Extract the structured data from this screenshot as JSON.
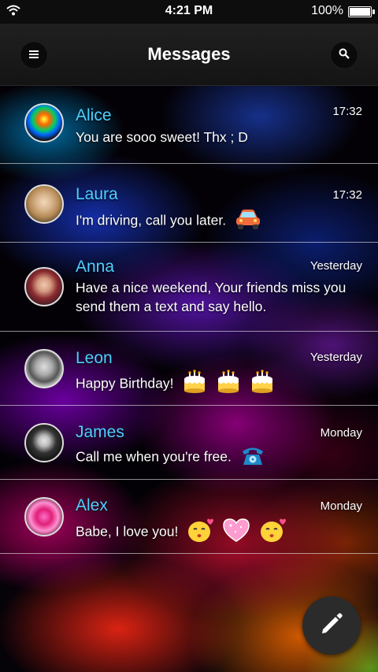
{
  "status_bar": {
    "time": "4:21 PM",
    "battery": "100%"
  },
  "header": {
    "title": "Messages",
    "menu_icon": "menu-icon",
    "search_icon": "search-icon"
  },
  "conversations": [
    {
      "name": "Alice",
      "time": "17:32",
      "message": "You are sooo sweet! Thx ; D",
      "emojis": []
    },
    {
      "name": "Laura",
      "time": "17:32",
      "message": "I'm driving, call you later.",
      "emojis": [
        "car-emoji"
      ]
    },
    {
      "name": "Anna",
      "time": "Yesterday",
      "message": "Have a nice weekend, Your friends miss you send them a text and say hello.",
      "emojis": []
    },
    {
      "name": "Leon",
      "time": "Yesterday",
      "message": "Happy Birthday!",
      "emojis": [
        "cake-emoji",
        "cake-emoji",
        "cake-emoji"
      ]
    },
    {
      "name": "James",
      "time": "Monday",
      "message": "Call me when you're free.",
      "emojis": [
        "telephone-emoji"
      ]
    },
    {
      "name": "Alex",
      "time": "Monday",
      "message": "Babe, I love you!",
      "emojis": [
        "kiss-face-emoji",
        "heart-emoji",
        "kiss-face-emoji"
      ]
    }
  ],
  "compose_icon": "pencil-icon"
}
